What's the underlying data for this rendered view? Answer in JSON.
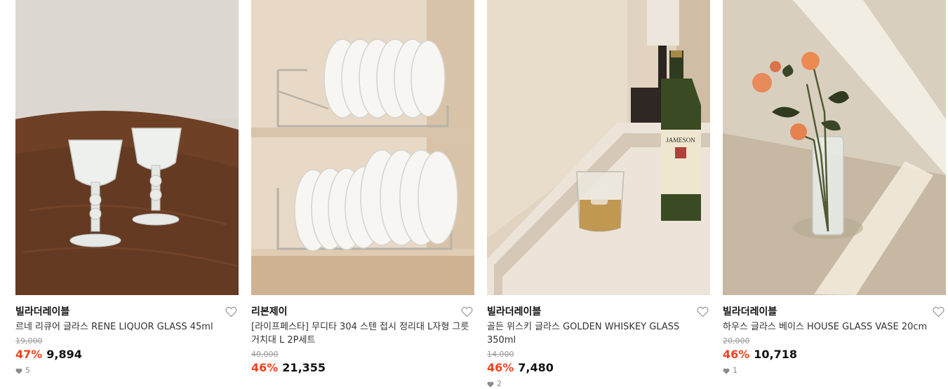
{
  "products": [
    {
      "brand": "빌라더레이블",
      "name": "르네 리큐어 글라스 RENE LIQUOR GLASS 45ml",
      "original_price": "19,000",
      "discount_rate": "47%",
      "price": "9,894",
      "likes": "5",
      "image": "liquor-glasses-photo"
    },
    {
      "brand": "리본제이",
      "name": "[라이프페스타] 무디타 304 스텐 접시 정리대 L자형 그릇 거치대 L 2P세트",
      "original_price": "40,000",
      "discount_rate": "46%",
      "price": "21,355",
      "likes": "",
      "image": "dish-rack-photo"
    },
    {
      "brand": "빌라더레이블",
      "name": "골든 위스키 글라스 GOLDEN WHISKEY GLASS 350ml",
      "original_price": "14,000",
      "discount_rate": "46%",
      "price": "7,480",
      "likes": "2",
      "image": "whiskey-glass-photo"
    },
    {
      "brand": "빌라더레이블",
      "name": "하우스 글라스 베이스 HOUSE GLASS VASE 20cm",
      "original_price": "20,000",
      "discount_rate": "46%",
      "price": "10,718",
      "likes": "1",
      "image": "glass-vase-photo"
    }
  ],
  "colors": {
    "discount": "#f0431f",
    "strike": "#9a9a9a"
  },
  "icons": {
    "wishlist": "heart-outline-icon",
    "likes": "heart-filled-icon"
  }
}
